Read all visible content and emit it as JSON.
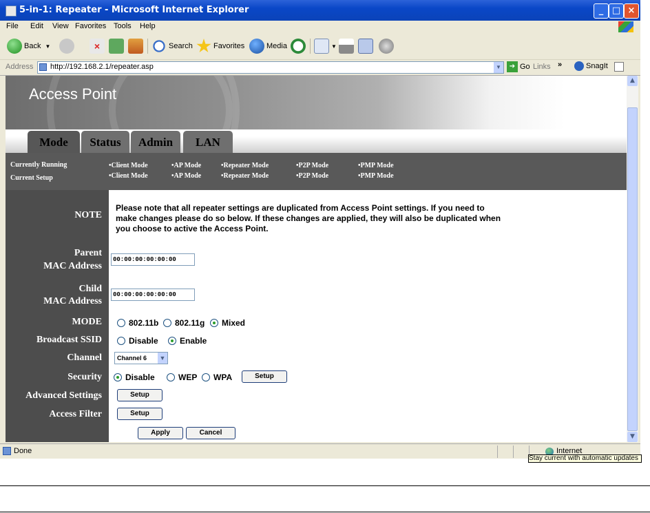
{
  "window": {
    "title": "5-in-1: Repeater - Microsoft Internet Explorer",
    "minimize": "_",
    "maximize": "□",
    "close": "×"
  },
  "menu": [
    "File",
    "Edit",
    "View",
    "Favorites",
    "Tools",
    "Help"
  ],
  "toolbar": {
    "back": "Back",
    "search": "Search",
    "favorites": "Favorites",
    "media": "Media"
  },
  "address": {
    "label": "Address",
    "url": "http://192.168.2.1/repeater.asp",
    "go": "Go",
    "links": "Links",
    "snagit": "SnagIt"
  },
  "banner": {
    "title": "Access Point"
  },
  "tabs": [
    {
      "label": "Mode"
    },
    {
      "label": "Status"
    },
    {
      "label": "Admin"
    },
    {
      "label": "LAN"
    }
  ],
  "status_grid": {
    "running_label": "Currently Running",
    "setup_label": "Current Setup",
    "modes": [
      "•Client Mode",
      "•AP Mode",
      "•Repeater Mode",
      "•P2P Mode",
      "•PMP Mode"
    ]
  },
  "form": {
    "note_label": "NOTE",
    "note_text": "Please note that all repeater settings are duplicated from Access Point settings. If you need to make changes please do so below. If these changes are applied, they will also be duplicated when you choose to active the Access Point.",
    "parent_label_1": "Parent",
    "parent_label_2": "MAC Address",
    "parent_value": "00:00:00:00:00:00",
    "child_label_1": "Child",
    "child_label_2": "MAC Address",
    "child_value": "00:00:00:00:00:00",
    "mode_label": "MODE",
    "mode_options": [
      "802.11b",
      "802.11g",
      "Mixed"
    ],
    "mode_selected": "Mixed",
    "ssid_label": "Broadcast SSID",
    "ssid_options": [
      "Disable",
      "Enable"
    ],
    "ssid_selected": "Enable",
    "channel_label": "Channel",
    "channel_value": "Channel 6",
    "security_label": "Security",
    "security_options": [
      "Disable",
      "WEP",
      "WPA"
    ],
    "security_selected": "Disable",
    "setup_button": "Setup",
    "advanced_label": "Advanced Settings",
    "filter_label": "Access Filter",
    "apply_button": "Apply",
    "cancel_button": "Cancel"
  },
  "statusbar": {
    "text": "Done",
    "zone": "Internet",
    "tooltip": "Stay current with automatic updates"
  }
}
